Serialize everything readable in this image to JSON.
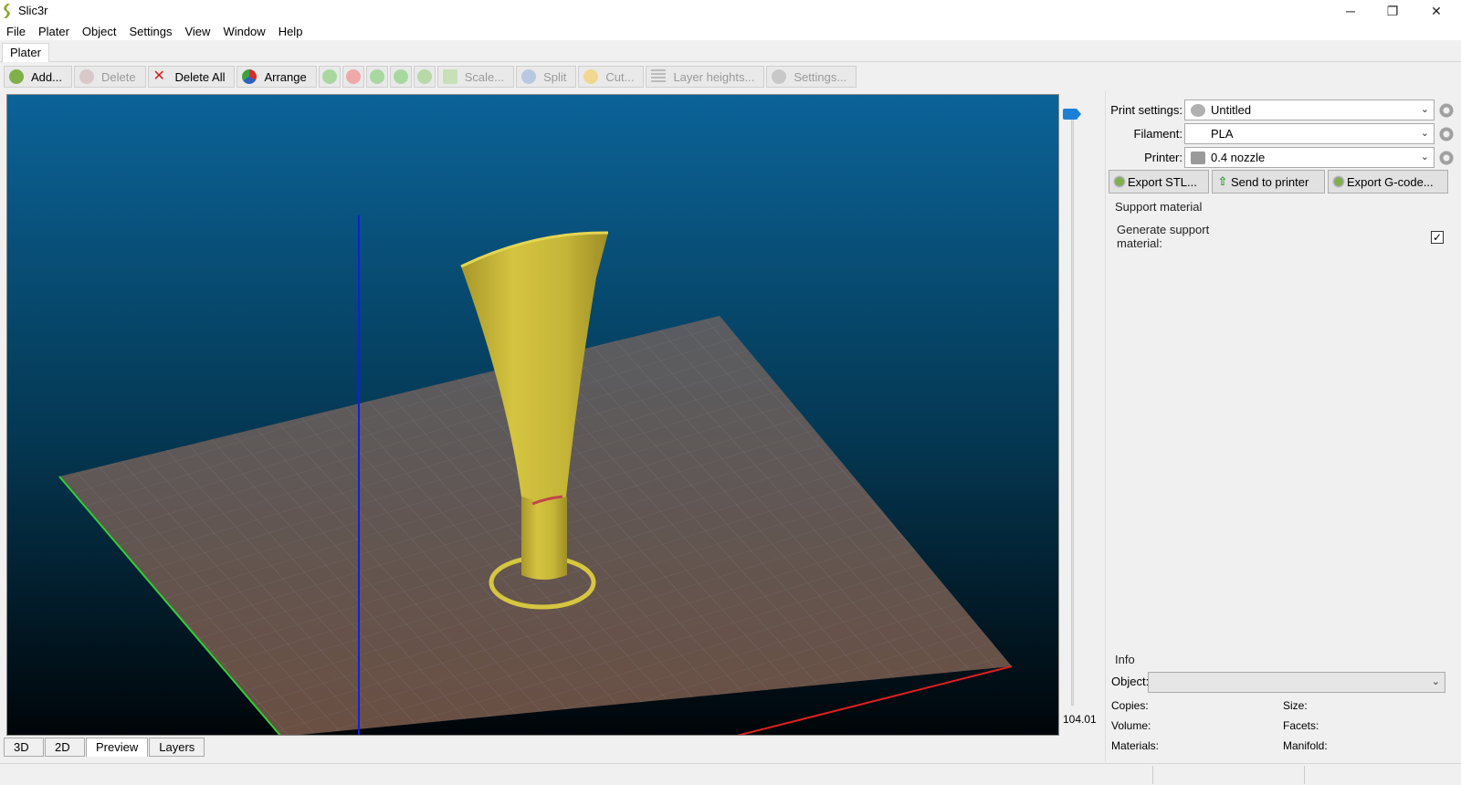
{
  "window": {
    "title": "Slic3r",
    "minimize_glyph": "─",
    "restore_glyph": "❐",
    "close_glyph": "✕"
  },
  "menu": [
    "File",
    "Plater",
    "Object",
    "Settings",
    "View",
    "Window",
    "Help"
  ],
  "tabs": {
    "plater": "Plater"
  },
  "toolbar": {
    "add": "Add...",
    "delete": "Delete",
    "delete_all": "Delete All",
    "arrange": "Arrange",
    "scale": "Scale...",
    "split": "Split",
    "cut": "Cut...",
    "layer_heights": "Layer heights...",
    "settings": "Settings..."
  },
  "viewport": {
    "layer_value": "104.01"
  },
  "view_tabs": [
    "3D",
    "2D",
    "Preview",
    "Layers"
  ],
  "presets": {
    "print_label": "Print settings:",
    "print_value": "Untitled",
    "filament_label": "Filament:",
    "filament_value": "PLA",
    "printer_label": "Printer:",
    "printer_value": "0.4 nozzle"
  },
  "actions": {
    "export_stl": "Export STL...",
    "send_to_printer": "Send to printer",
    "export_gcode": "Export G-code..."
  },
  "support": {
    "title": "Support material",
    "generate_label_1": "Generate support",
    "generate_label_2": "material:",
    "checked_glyph": "✓"
  },
  "info": {
    "title": "Info",
    "object_label": "Object:",
    "copies": "Copies:",
    "size": "Size:",
    "volume": "Volume:",
    "facets": "Facets:",
    "materials": "Materials:",
    "manifold": "Manifold:"
  },
  "colors": {
    "accent": "#1e7fd6",
    "model": "#c9b93a",
    "bed": "#5a5a5a"
  }
}
